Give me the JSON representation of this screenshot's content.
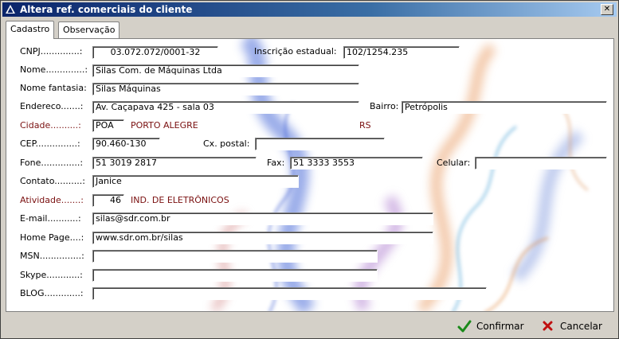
{
  "window": {
    "title": "Altera ref. comerciais do cliente",
    "close_label": "✕"
  },
  "tabs": [
    {
      "label": "Cadastro",
      "active": true
    },
    {
      "label": "Observação",
      "active": false
    }
  ],
  "form": {
    "cnpj": {
      "label": "CNPJ..............:",
      "value": "03.072.072/0001-32"
    },
    "inscricao": {
      "label": "Inscrição estadual:",
      "value": "102/1254.235"
    },
    "nome": {
      "label": "Nome..............:",
      "value": "Silas Com. de Máquinas Ltda"
    },
    "nome_fantasia": {
      "label": "Nome fantasia:",
      "value": "Silas Máquinas"
    },
    "endereco": {
      "label": "Endereco.......:",
      "value": "Av. Caçapava 425 - sala 03"
    },
    "bairro": {
      "label": "Bairro:",
      "value": "Petrópolis"
    },
    "cidade": {
      "label": "Cidade..........:",
      "code": "POA",
      "name": "PORTO ALEGRE",
      "uf": "RS"
    },
    "cep": {
      "label": "CEP...............:",
      "value": "90.460-130"
    },
    "cx_postal": {
      "label": "Cx. postal:",
      "value": ""
    },
    "fone": {
      "label": "Fone..............:",
      "value": "51 3019 2817"
    },
    "fax": {
      "label": "Fax:",
      "value": "51 3333 3553"
    },
    "celular": {
      "label": "Celular:",
      "value": ""
    },
    "contato": {
      "label": "Contato..........:",
      "value": "Janice"
    },
    "atividade": {
      "label": "Atividade.......:",
      "code": "46",
      "name": "IND. DE ELETRÔNICOS"
    },
    "email": {
      "label": "E-mail...........:",
      "value": "silas@sdr.com.br"
    },
    "home_page": {
      "label": "Home Page....:",
      "value": "www.sdr.om.br/silas"
    },
    "msn": {
      "label": "MSN...............:",
      "value": ""
    },
    "skype": {
      "label": "Skype............:",
      "value": ""
    },
    "blog": {
      "label": "BLOG.............:",
      "value": ""
    }
  },
  "footer": {
    "confirm_label": "Confirmar",
    "cancel_label": "Cancelar"
  },
  "colors": {
    "title_start": "#0a246a",
    "accent_red_label": "#7a1010",
    "confirm_icon": "#1a8a1a",
    "cancel_icon": "#c01010"
  },
  "icons": {
    "app": "app-icon",
    "confirm": "checkmark-icon",
    "cancel": "x-icon",
    "close": "close-icon"
  }
}
